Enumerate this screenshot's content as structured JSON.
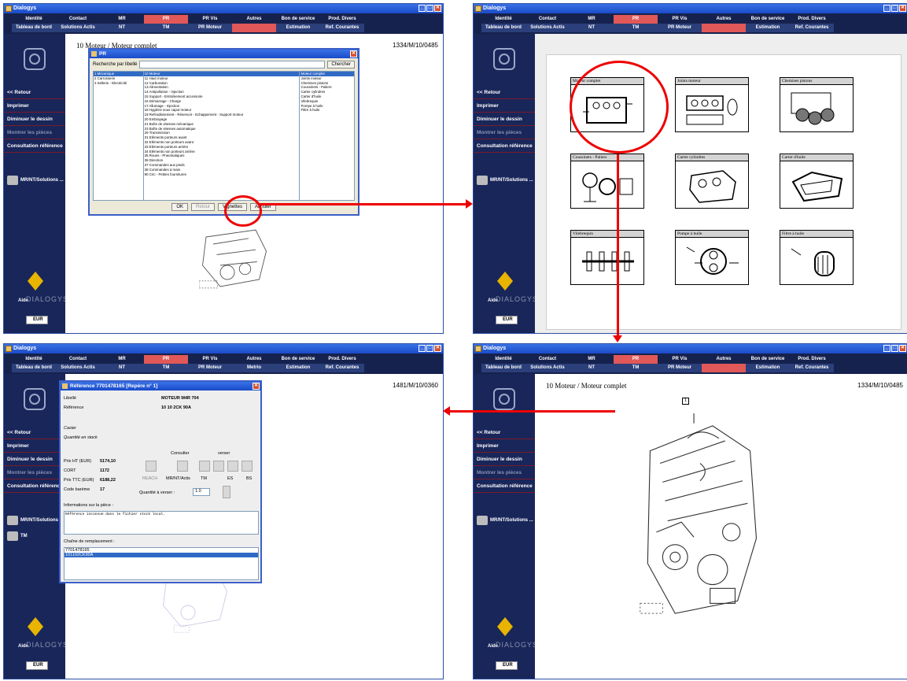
{
  "app_title": "Dialogys",
  "menu": {
    "row1": [
      "Identité",
      "Contact",
      "MR",
      "PR",
      "PR Vis",
      "Autres",
      "Bon de service",
      "Prod. Divers"
    ],
    "row2": [
      "Tableau de bord",
      "Solutions Actis",
      "NT",
      "TM",
      "PR Moteur",
      "",
      "Estimation",
      "Ref. Courantes"
    ],
    "row2_p3": [
      "Tableau de bord",
      "Solutions Actis",
      "NT",
      "TM",
      "PR Moteur",
      "Metrio",
      "Estimation",
      "Ref. Courantes"
    ],
    "selected": "PR"
  },
  "sidebar": {
    "back": "<< Retour",
    "print": "Imprimer",
    "shrink": "Diminuer le dessin",
    "show_parts": "Montrer les pièces",
    "consult": "Consultation référence",
    "mr_nt": "MR/NT/Solutions ...",
    "tm": "TM",
    "aide": "Aide",
    "dialogys": "DIALOGYS",
    "eur": "EUR"
  },
  "panel1": {
    "title": "10 Moteur / Moteur complet",
    "ref": "1334/M/10/0485",
    "dialog": {
      "title": "PR",
      "search_label": "Recherche par libellé",
      "search_btn": "Chercher",
      "col1": [
        "1 Mécanique",
        "2 Carrosserie",
        "3 Sellerie - Electricité"
      ],
      "col2": [
        "10 Moteur",
        "11 Haut moteur",
        "12 Carburation",
        "13 Alimentation",
        "14 Antipollution - Injection",
        "15 Support - Entraînement accessoire",
        "16 Démarrage - Charge",
        "17 Allumage - Injection",
        "18 Hygiène sous capot moteur",
        "19 Refroidissement - Réservoir - Echappement - Support moteur",
        "20 Embrayage",
        "21 Boîte de vitesses mécanique",
        "23 Boîte de vitesses automatique",
        "29 Transmission",
        "31 Eléments porteurs avant",
        "32 Eléments non porteurs avant",
        "33 Eléments porteurs arrière",
        "34 Eléments non porteurs arrière",
        "35 Roues - Pneumatiques",
        "36 Direction",
        "37 Commandes aux pieds",
        "38 Commandes à main",
        "90 Cric - Petites fournitures"
      ],
      "col3": [
        "Moteur complet",
        "Joints moteur",
        "Chemises pistons",
        "Coussinets - Paliers",
        "Carter cylindres",
        "Carter d'huile",
        "Vilebrequin",
        "Pompe à huile",
        "Filtre à huile"
      ],
      "ok": "OK",
      "retour": "Retour",
      "vignettes": "Vignettes",
      "annuler": "Annuler"
    }
  },
  "panel2": {
    "thumbs": [
      "Moteur complet",
      "Joints moteur",
      "Chemises pistons",
      "Coussinets - Paliers",
      "Carter cylindres",
      "Carter d'huile",
      "Vilebrequin",
      "Pompe à huile",
      "Filtre à huile"
    ]
  },
  "panel3": {
    "ref": "1481/M/10/0360",
    "dialog": {
      "title": "Référence 7701478165 [Repère n° 1]",
      "libelle_lbl": "Libellé",
      "libelle_val": "MOTEUR M4R 704",
      "reference_lbl": "Référence",
      "reference_val": "10 10 2CK 90A",
      "casier": "Casier",
      "stock": "Quantité en stock",
      "consulter": "Consulter",
      "verser": "verser",
      "prix_ht_lbl": "Prix HT (EUR)",
      "prix_ht_val": "5174,10",
      "cort_lbl": "CORT",
      "cort_val": "1172",
      "prix_ttc_lbl": "Prix TTC (EUR)",
      "prix_ttc_val": "6188,22",
      "bareme_lbl": "Code barème",
      "bareme_val": "17",
      "reach": "REACH",
      "mrntactis": "MR/NT/Actis",
      "tm": "TM",
      "es": "ES",
      "bs": "BS",
      "qty_lbl": "Quantité à verser :",
      "qty_val": "1.0",
      "info_lbl": "Informations sur la pièce :",
      "info_text": "Référence inconnue dans le fichier stock local.",
      "chain_lbl": "Chaîne de remplacement :",
      "chain": [
        "7701478165",
        "101102CK90A"
      ]
    }
  },
  "panel4": {
    "title": "10 Moteur / Moteur complet",
    "ref": "1334/M/10/0485",
    "marker": "1"
  }
}
